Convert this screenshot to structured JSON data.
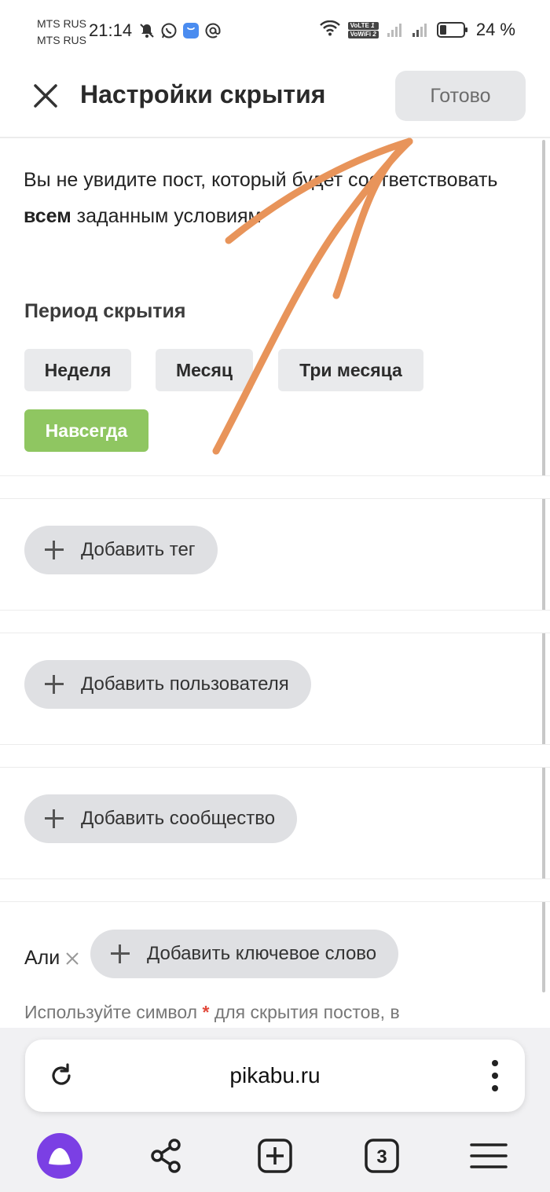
{
  "status_bar": {
    "carrier_1": "MTS RUS",
    "carrier_2": "MTS RUS",
    "time": "21:14",
    "volte": "VoLTE",
    "volte_index": "1",
    "vowifi": "VoWiFi",
    "vowifi_index": "2",
    "battery": "24 %",
    "icons": [
      "bell-off-icon",
      "whatsapp-icon",
      "store-icon",
      "at-sign-icon",
      "wifi-icon",
      "signal-icon",
      "signal-icon",
      "battery-icon"
    ]
  },
  "header": {
    "title": "Настройки скрытия",
    "done_label": "Готово"
  },
  "intro": {
    "text_before": "Вы не увидите пост, который будет соответствовать ",
    "text_bold": "всем",
    "text_after": " заданным условиям"
  },
  "period": {
    "label": "Период скрытия",
    "options": [
      "Неделя",
      "Месяц",
      "Три месяца",
      "Навсегда"
    ],
    "selected": "Навсегда"
  },
  "add_buttons": {
    "tag": "Добавить тег",
    "user": "Добавить пользователя",
    "community": "Добавить сообщество",
    "keyword": "Добавить ключевое слово"
  },
  "keywords": [
    "Али"
  ],
  "hint": {
    "before": "Используйте символ ",
    "star": "*",
    "after": " для скрытия постов, в"
  },
  "browser": {
    "url": "pikabu.ru",
    "tabs_count": "3"
  },
  "colors": {
    "accent_green": "#8fc661",
    "annotation_arrow": "#e8945a",
    "chip_bg": "#e9eaec",
    "alice_purple": "#7b3fe4"
  }
}
